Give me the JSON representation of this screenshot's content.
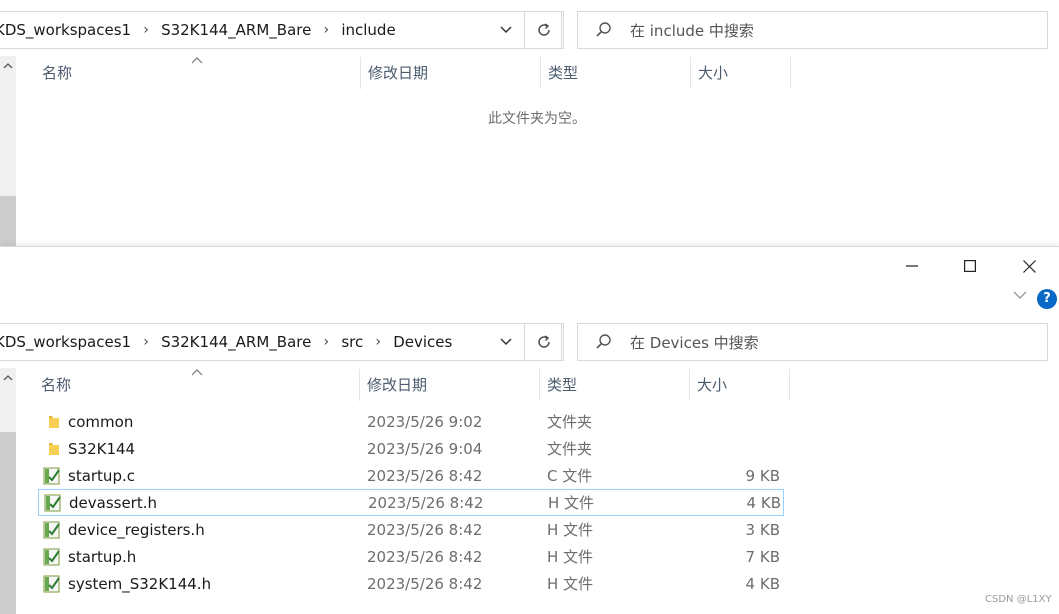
{
  "window_top": {
    "breadcrumbs": [
      "KDS_workspaces1",
      "S32K144_ARM_Bare",
      "include"
    ],
    "search_placeholder": "在 include 中搜索",
    "columns": [
      "名称",
      "修改日期",
      "类型",
      "大小"
    ],
    "empty_message": "此文件夹为空。"
  },
  "window_bottom": {
    "breadcrumbs": [
      "KDS_workspaces1",
      "S32K144_ARM_Bare",
      "src",
      "Devices"
    ],
    "search_placeholder": "在 Devices 中搜索",
    "columns": [
      "名称",
      "修改日期",
      "类型",
      "大小"
    ],
    "help_label": "?",
    "files": [
      {
        "name": "common",
        "date": "2023/5/26 9:02",
        "type": "文件夹",
        "size": "",
        "icon": "folder-icon"
      },
      {
        "name": "S32K144",
        "date": "2023/5/26 9:04",
        "type": "文件夹",
        "size": "",
        "icon": "folder-icon"
      },
      {
        "name": "startup.c",
        "date": "2023/5/26 8:42",
        "type": "C 文件",
        "size": "9 KB",
        "icon": "source-file-icon"
      },
      {
        "name": "devassert.h",
        "date": "2023/5/26 8:42",
        "type": "H 文件",
        "size": "4 KB",
        "icon": "source-file-icon",
        "selected": true
      },
      {
        "name": "device_registers.h",
        "date": "2023/5/26 8:42",
        "type": "H 文件",
        "size": "3 KB",
        "icon": "source-file-icon"
      },
      {
        "name": "startup.h",
        "date": "2023/5/26 8:42",
        "type": "H 文件",
        "size": "7 KB",
        "icon": "source-file-icon"
      },
      {
        "name": "system_S32K144.h",
        "date": "2023/5/26 8:42",
        "type": "H 文件",
        "size": "4 KB",
        "icon": "source-file-icon"
      }
    ]
  },
  "watermark": "CSDN @L1XY",
  "colors": {
    "accent": "#0a68c6",
    "selection_border": "#99d1ff",
    "folder": "#f5c542"
  }
}
